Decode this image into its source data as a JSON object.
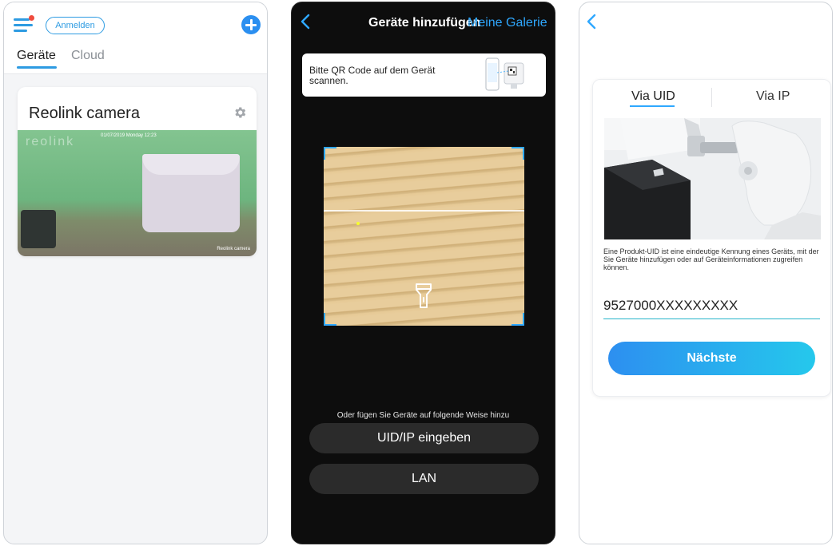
{
  "screen1": {
    "login_label": "Anmelden",
    "tabs": [
      {
        "label": "Geräte",
        "active": true
      },
      {
        "label": "Cloud",
        "active": false
      }
    ],
    "camera": {
      "name": "Reolink camera",
      "thumb_logo": "reolink",
      "thumb_osd_top": "01/07/2019  Monday 12:23",
      "thumb_osd_bottom": "Reolink camera"
    },
    "accent_color": "#2d9be2"
  },
  "screen2": {
    "title": "Geräte hinzufügen",
    "gallery_link": "Meine Galerie",
    "hint": "Bitte QR Code auf dem Gerät scannen.",
    "alt_methods_label": "Oder fügen Sie Geräte auf folgende Weise hinzu",
    "buttons": {
      "uid_ip": "UID/IP eingeben",
      "lan": "LAN"
    },
    "accent_color": "#2fa8ff"
  },
  "screen3": {
    "tabs": [
      {
        "label": "Via UID",
        "active": true
      },
      {
        "label": "Via IP",
        "active": false
      }
    ],
    "description": "Eine Produkt-UID ist eine eindeutige Kennung eines Geräts, mit der Sie Geräte hinzufügen oder auf Geräteinformationen zugreifen können.",
    "uid_placeholder": "9527000XXXXXXXXX",
    "next_label": "Nächste",
    "accent_color": "#2fa8ff"
  }
}
